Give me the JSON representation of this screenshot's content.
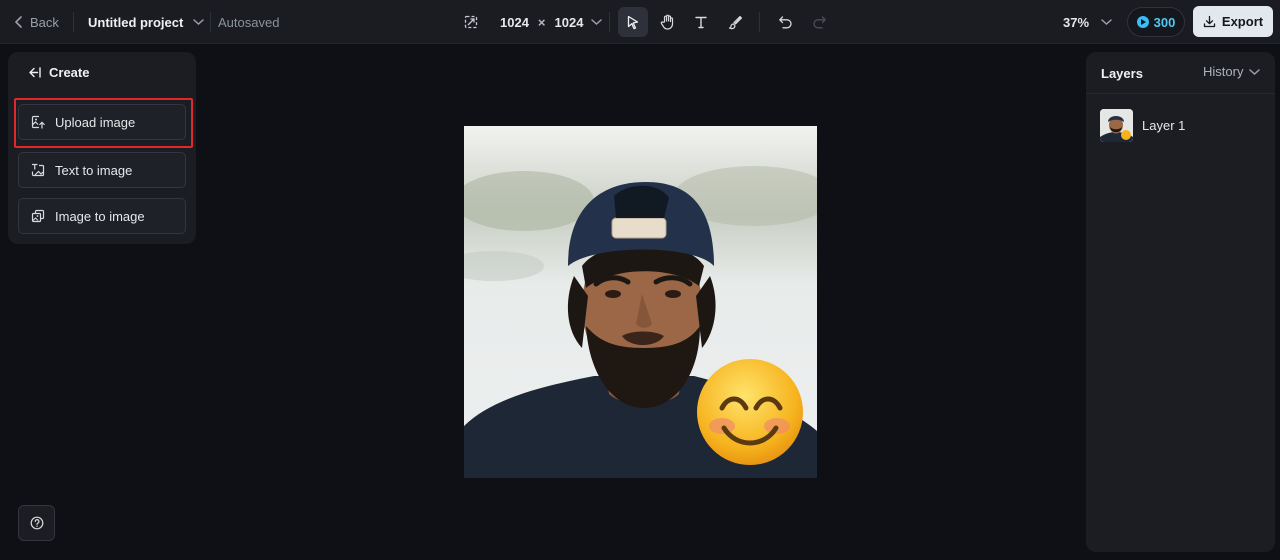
{
  "topbar": {
    "back_label": "Back",
    "project_name": "Untitled project",
    "save_status": "Autosaved",
    "canvas_width": "1024",
    "canvas_times": "×",
    "canvas_height": "1024",
    "zoom": "37%",
    "credits": "300",
    "export_label": "Export"
  },
  "left_panel": {
    "title": "Create",
    "buttons": [
      {
        "label": "Upload image",
        "icon": "upload-image-icon"
      },
      {
        "label": "Text to image",
        "icon": "text-to-image-icon"
      },
      {
        "label": "Image to image",
        "icon": "image-to-image-icon"
      }
    ],
    "highlighted_button": "Upload image"
  },
  "right_panel": {
    "tab_layers": "Layers",
    "tab_history": "History",
    "layers": [
      {
        "name": "Layer 1"
      }
    ]
  },
  "colors": {
    "accent_highlight": "#e0272b",
    "credits_blue": "#38bdf8",
    "background": "#0f1015",
    "panel": "#1b1d23"
  }
}
